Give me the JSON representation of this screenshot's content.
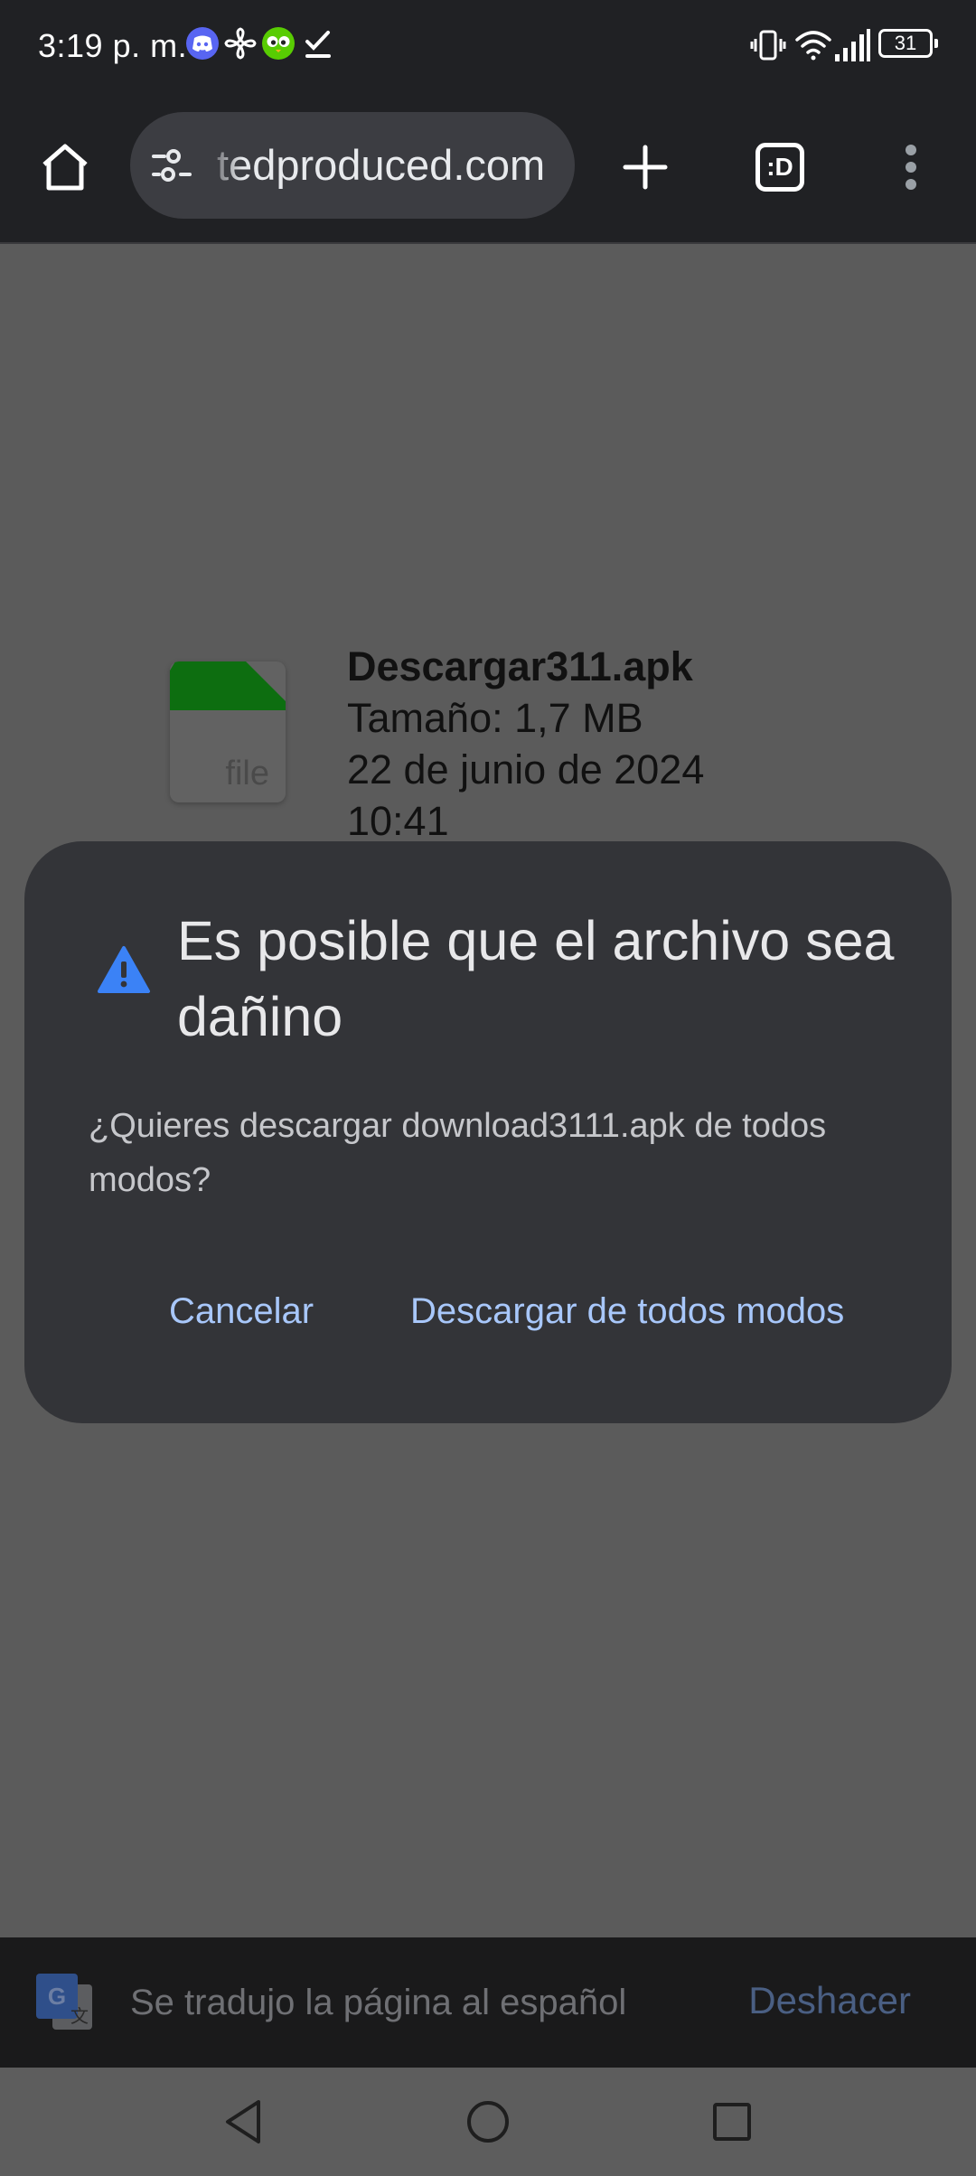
{
  "status_bar": {
    "time": "3:19 p. m.",
    "battery_level": "31",
    "notification_icons": [
      "discord-icon",
      "pinwheel-icon",
      "duolingo-icon",
      "checkmark-icon"
    ],
    "system_icons": [
      "vibrate-icon",
      "wifi-icon",
      "signal-icon",
      "battery-icon"
    ]
  },
  "toolbar": {
    "url": "tedproduced.com",
    "tab_switcher_label": ":D"
  },
  "file_info": {
    "thumbnail_label": "file",
    "name": "Descargar311.apk",
    "size": "Tamaño: 1,7 MB",
    "date": "22 de junio de 2024",
    "time": "10:41",
    "accent_color": "#0d6e10"
  },
  "dialog": {
    "title": "Es posible que el archivo sea dañino",
    "body": "¿Quieres descargar download3111.apk de todos modos?",
    "cancel_label": "Cancelar",
    "confirm_label": "Descargar de todos modos",
    "icon": "warning-icon",
    "accent_color": "#a8c7fa",
    "warning_color": "#3b82f6"
  },
  "translate_bar": {
    "message": "Se tradujo la página al español",
    "undo_label": "Deshacer"
  }
}
